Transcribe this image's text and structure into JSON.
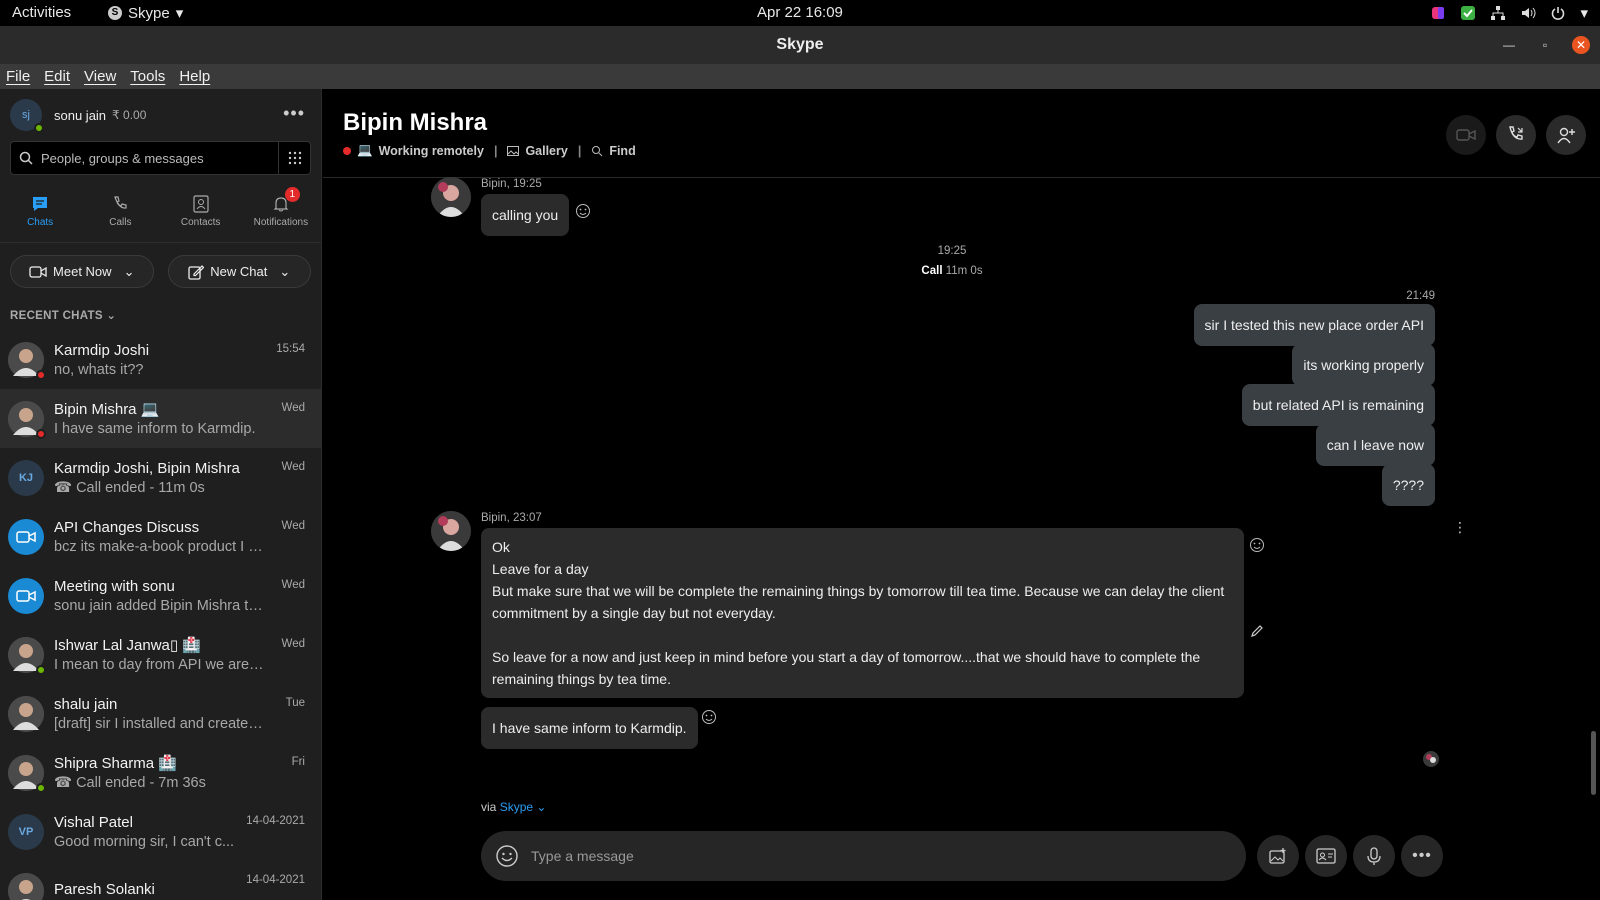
{
  "topbar": {
    "activities": "Activities",
    "app": "Skype",
    "clock": "Apr 22  16:09"
  },
  "window": {
    "title": "Skype"
  },
  "menu": [
    "File",
    "Edit",
    "View",
    "Tools",
    "Help"
  ],
  "profile": {
    "initials": "sj",
    "name": "sonu jain",
    "balance": "₹ 0.00"
  },
  "search": {
    "placeholder": "People, groups & messages"
  },
  "nav": {
    "chats": "Chats",
    "calls": "Calls",
    "contacts": "Contacts",
    "notifications": "Notifications",
    "notif_count": "1"
  },
  "actions": {
    "meet_now": "Meet Now",
    "new_chat": "New Chat"
  },
  "recent_header": "RECENT CHATS",
  "chats": [
    {
      "name": "Karmdip Joshi",
      "preview": "no, whats it??",
      "time": "15:54",
      "avatar": "photo",
      "status": "red"
    },
    {
      "name": "Bipin Mishra 💻",
      "preview": "I have same inform to Karmdip.",
      "time": "Wed",
      "avatar": "photo",
      "status": "red"
    },
    {
      "name": "Karmdip Joshi, Bipin Mishra",
      "preview": "☎ Call ended - 11m 0s",
      "time": "Wed",
      "avatar": "KJ",
      "status": ""
    },
    {
      "name": "API Changes Discuss",
      "preview": "bcz its make-a-book product I h...",
      "time": "Wed",
      "avatar": "meet",
      "status": ""
    },
    {
      "name": "Meeting with sonu",
      "preview": "sonu jain added Bipin Mishra to t...",
      "time": "Wed",
      "avatar": "meet",
      "status": ""
    },
    {
      "name": "Ishwar Lal Janwa▯ 🏥",
      "preview": "I mean to day from API we are se...",
      "time": "Wed",
      "avatar": "photo",
      "status": "green"
    },
    {
      "name": "shalu jain",
      "preview": "[draft] sir I installed and created a...",
      "time": "Tue",
      "avatar": "photo",
      "status": ""
    },
    {
      "name": "Shipra Sharma 🏥",
      "preview": "☎ Call ended - 7m 36s",
      "time": "Fri",
      "avatar": "photo",
      "status": "green"
    },
    {
      "name": "Vishal Patel",
      "preview": "Good morning sir, I can't c...",
      "time": "14-04-2021",
      "avatar": "VP",
      "status": ""
    },
    {
      "name": "Paresh Solanki",
      "preview": "",
      "time": "14-04-2021",
      "avatar": "photo",
      "status": ""
    }
  ],
  "conversation": {
    "title": "Bipin Mishra",
    "status": "Working remotely",
    "gallery": "Gallery",
    "find": "Find",
    "msg1_meta": "Bipin, 19:25",
    "msg1_text": "calling you",
    "call_time": "19:25",
    "call_label": "Call",
    "call_duration": "11m 0s",
    "mine_time": "21:49",
    "mine": [
      "sir I tested this new place order API",
      "its working properly",
      "but related API is remaining",
      "can I leave now",
      "????"
    ],
    "msg2_meta": "Bipin, 23:07",
    "msg2_lines": [
      "Ok",
      "Leave for a day",
      "But make sure that we will be complete the remaining things by tomorrow till tea time. Because we can delay the client commitment by a single day but not everyday.",
      "",
      "So leave for a now and just keep in mind before you start a day of tomorrow....that we should have to complete the remaining things by tea time."
    ],
    "msg3_text": "I have same inform to Karmdip.",
    "via": "via",
    "via_link": "Skype",
    "composer_placeholder": "Type a message"
  },
  "colors": {
    "accent": "#2a9df4",
    "bubble": "#2b2b2b",
    "bubble_mine": "#3a3f44",
    "online": "#6bb700",
    "busy": "#e32b2b"
  }
}
